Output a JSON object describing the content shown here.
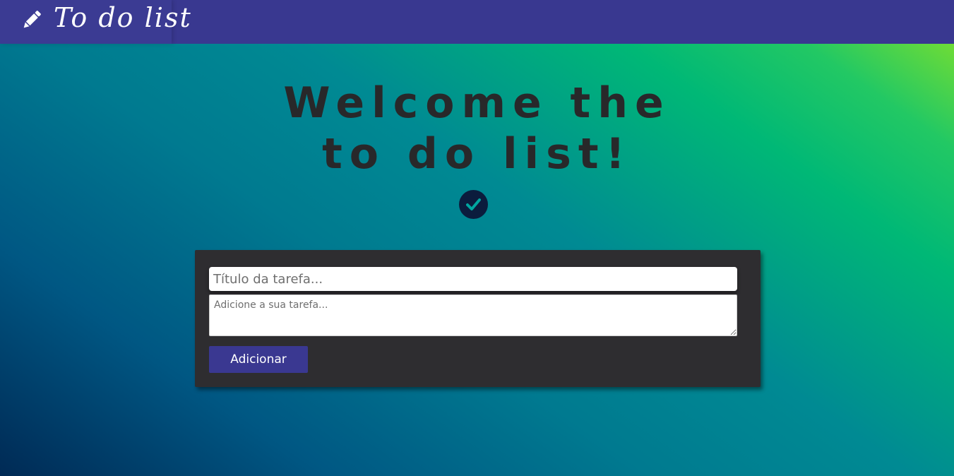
{
  "header": {
    "brand_title": "To do list",
    "brand_icon": "pencil-icon"
  },
  "hero": {
    "title_line1": "Welcome the",
    "title_line2": "to do list!",
    "badge_icon": "check-circle-icon"
  },
  "form": {
    "title_placeholder": "Título da tarefa...",
    "description_placeholder": "Adicione a sua tarefa...",
    "add_label": "Adicionar"
  },
  "colors": {
    "topbar": "#393890",
    "card": "#2e2d30",
    "button": "#3a3891",
    "heading": "#28282a",
    "badge": "#0b1c3d"
  }
}
